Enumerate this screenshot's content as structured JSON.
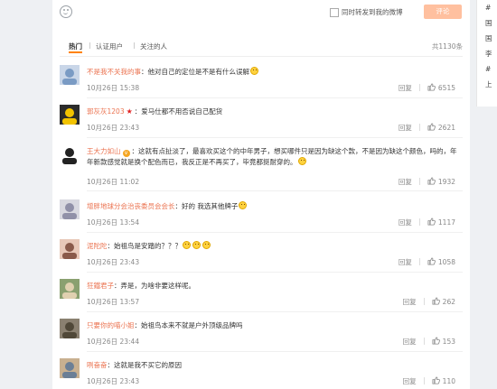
{
  "toolbar": {
    "repost_label": "同时转发到我的微博",
    "comment_button": "评论"
  },
  "tabs": [
    {
      "label": "热门"
    },
    {
      "label": "认证用户"
    },
    {
      "label": "关注的人"
    }
  ],
  "total_label": "共1130条",
  "sidebar": {
    "items": [
      "#",
      "国",
      "国",
      "李",
      "#",
      "上"
    ]
  },
  "reply_label": "回复",
  "comments": [
    {
      "user": "不是我不关我的事",
      "text": "：他对自己的定位是不是有什么误解",
      "time": "10月26日 15:38",
      "likes": "6515",
      "badge": "",
      "emojis": 1
    },
    {
      "user": "郭灰灰1203",
      "text": "：爱马仕都不用否说自己配货",
      "time": "10月26日 23:43",
      "likes": "2621",
      "badge": "star",
      "emojis": 0
    },
    {
      "user": "王大力如山",
      "text": "：这就有点扯淡了，最喜欢买这个的中年男子，想买哪件只是因为缺这个款，不是因为缺这个颜色，吗的，年年新款感觉就是换个配色而已，我反正是不再买了，毕竟都挺耐穿的。",
      "time": "10月26日 11:02",
      "likes": "1932",
      "badge": "vip",
      "emojis": 1
    },
    {
      "user": "增胖地球分会治丧委员会会长",
      "text": "：好的 我选其他牌子",
      "time": "10月26日 13:54",
      "likes": "1117",
      "badge": "",
      "emojis": 1
    },
    {
      "user": "泥陀陀",
      "text": "：始祖鸟是安踏的？？？",
      "time": "10月26日 23:43",
      "likes": "1058",
      "badge": "",
      "emojis": 3
    },
    {
      "user": "狂鐵君子",
      "text": "：弄是，为啥非要这样呢。",
      "time": "10月26日 13:57",
      "likes": "262",
      "badge": "",
      "emojis": 0
    },
    {
      "user": "只要你的喵小姐",
      "text": "：始祖鸟本来不就是户外顶级品牌吗",
      "time": "10月26日 23:44",
      "likes": "153",
      "badge": "",
      "emojis": 0
    },
    {
      "user": "咧奋奋",
      "text": "：这就是我不买它的原因",
      "time": "10月26日 23:43",
      "likes": "110",
      "badge": "",
      "emojis": 0
    }
  ],
  "colors": {
    "accent": "#ff8200",
    "username": "#eb7350",
    "comment_button_bg": "#ffc09f",
    "star": "#e02020"
  },
  "icons": {
    "emoji_button": "smiley-icon",
    "like": "thumbs-up-icon",
    "vip": "vip-badge-icon"
  }
}
